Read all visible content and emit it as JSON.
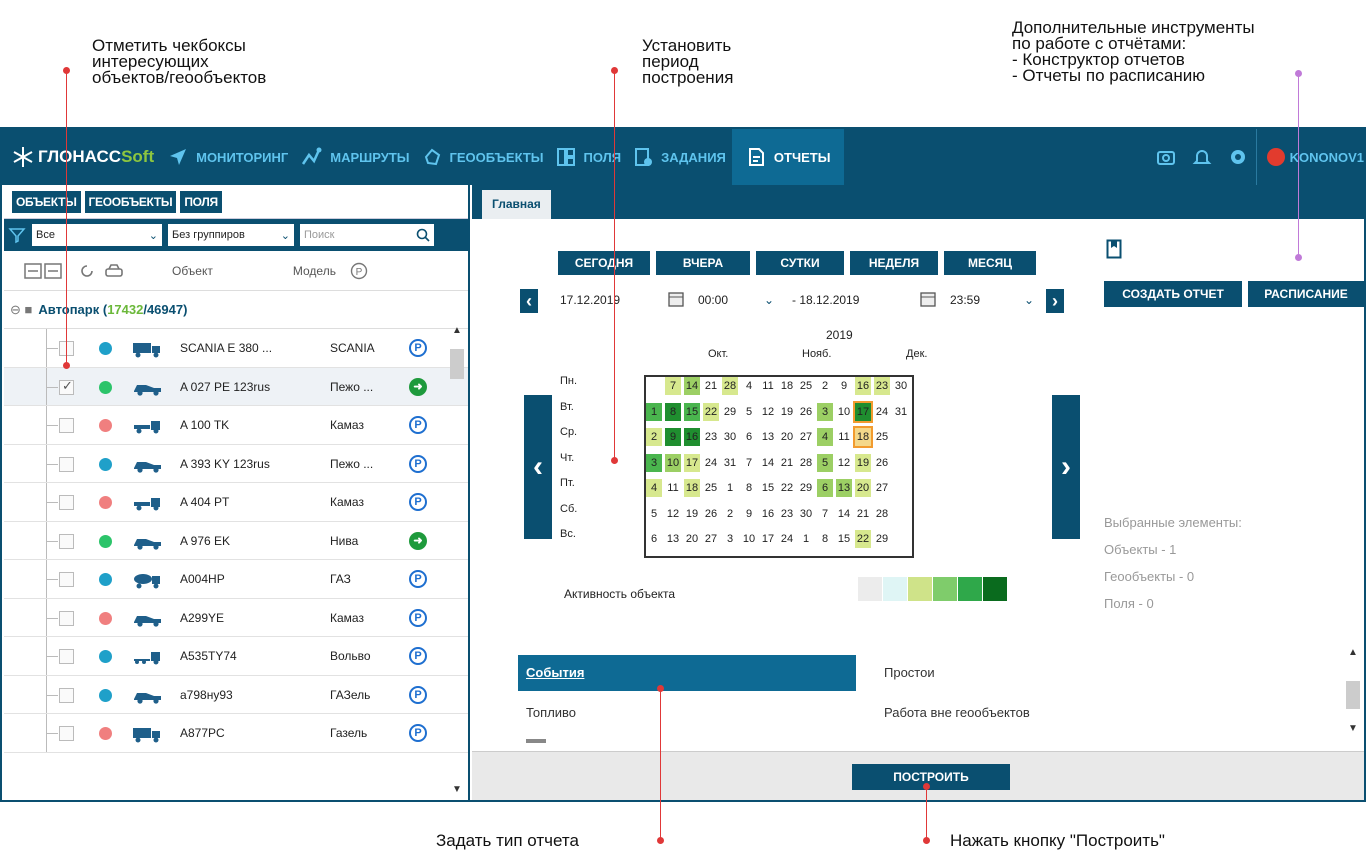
{
  "annotations": {
    "checkboxes": "Отметить чекбоксы\nинтересующих\nобъектов/геообъектов",
    "period": "Установить\nпериод\nпостроения",
    "tools": "Дополнительные инструменты\nпо работе с отчётами:\n- Конструктор отчетов\n- Отчеты по расписанию",
    "report_type": "Задать тип отчета",
    "build": "Нажать кнопку \"Построить\""
  },
  "nav": {
    "logo_a": "ГЛОНАСС",
    "logo_b": "Soft",
    "items": [
      "МОНИТОРИНГ",
      "МАРШРУТЫ",
      "ГЕООБЪЕКТЫ",
      "ПОЛЯ",
      "ЗАДАНИЯ",
      "ОТЧЕТЫ"
    ],
    "user": "KONONOV1"
  },
  "left": {
    "tabs": [
      "ОБЪЕКТЫ",
      "ГЕООБЪЕКТЫ",
      "ПОЛЯ"
    ],
    "filter_value": "Все",
    "group_value": "Без группиров",
    "search_placeholder": "Поиск",
    "col_object": "Объект",
    "col_model": "Модель",
    "group_label": "Автопарк (",
    "group_active": "17432",
    "group_total": "/46947)",
    "rows": [
      {
        "name": "SCANIA E 380 ...",
        "model": "SCANIA",
        "color": "#1fa0c9",
        "checked": false,
        "status": "P",
        "vehicle": "truck"
      },
      {
        "name": "A 027 PE 123rus",
        "model": "Пежо ...",
        "color": "#2cc46a",
        "checked": true,
        "status": "go",
        "vehicle": "car"
      },
      {
        "name": "A 100 TK",
        "model": "Камаз",
        "color": "#f07f7f",
        "checked": false,
        "status": "P",
        "vehicle": "lorry"
      },
      {
        "name": "A 393 KY 123rus",
        "model": "Пежо ...",
        "color": "#1fa0c9",
        "checked": false,
        "status": "P",
        "vehicle": "car"
      },
      {
        "name": "A 404 PT",
        "model": "Камаз",
        "color": "#f07f7f",
        "checked": false,
        "status": "P",
        "vehicle": "lorry"
      },
      {
        "name": "A 976 EK",
        "model": "Нива",
        "color": "#2cc46a",
        "checked": false,
        "status": "go",
        "vehicle": "car"
      },
      {
        "name": "A004HP",
        "model": "ГАЗ",
        "color": "#1fa0c9",
        "checked": false,
        "status": "P",
        "vehicle": "tank"
      },
      {
        "name": "A299YE",
        "model": "Камаз",
        "color": "#f07f7f",
        "checked": false,
        "status": "P",
        "vehicle": "car"
      },
      {
        "name": "A535TY74",
        "model": "Вольво",
        "color": "#1fa0c9",
        "checked": false,
        "status": "P",
        "vehicle": "trailer"
      },
      {
        "name": "a798ну93",
        "model": "ГАЗель",
        "color": "#1fa0c9",
        "checked": false,
        "status": "P",
        "vehicle": "car"
      },
      {
        "name": "A877PC",
        "model": "Газель",
        "color": "#f07f7f",
        "checked": false,
        "status": "P",
        "vehicle": "truck"
      }
    ]
  },
  "right": {
    "tab": "Главная",
    "period_buttons": [
      "СЕГОДНЯ",
      "ВЧЕРА",
      "СУТКИ",
      "НЕДЕЛЯ",
      "МЕСЯЦ"
    ],
    "date_from": "17.12.2019",
    "time_from": "00:00",
    "date_to": "- 18.12.2019",
    "time_to": "23:59",
    "year": "2019",
    "months": [
      "Окт.",
      "Нояб.",
      "Дек."
    ],
    "days": [
      "Пн.",
      "Вт.",
      "Ср.",
      "Чт.",
      "Пт.",
      "Сб.",
      "Вс."
    ],
    "activity_label": "Активность объекта",
    "activity_colors": [
      "#ececec",
      "#dff5f5",
      "#cfe389",
      "#7fcc6b",
      "#2fa84a",
      "#0a6b1e"
    ],
    "create_report": "СОЗДАТЬ ОТЧЕТ",
    "schedule": "РАСПИСАНИЕ",
    "selected_title": "Выбранные элементы:",
    "selected_objects": "Объекты - 1",
    "selected_geo": "Геообъекты - 0",
    "selected_fields": "Поля - 0",
    "reports_left": [
      "События",
      "Топливо"
    ],
    "reports_right": [
      "Простои",
      "Работа вне геообъектов"
    ],
    "build_button": "ПОСТРОИТЬ"
  }
}
